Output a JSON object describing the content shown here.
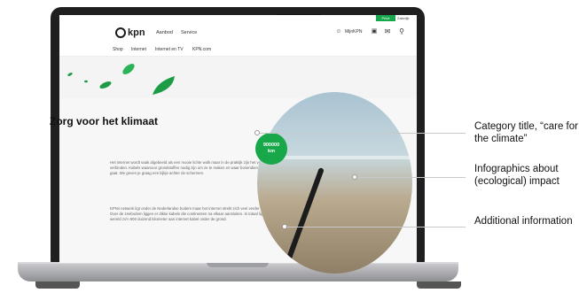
{
  "site": {
    "logo_text": "kpn",
    "top_buttons": {
      "prive": "Privé",
      "zakelijk": "Zakelijk"
    },
    "nav": [
      "Aanbod",
      "Service"
    ],
    "utility": {
      "account": "MijnKPN"
    },
    "subnav": [
      "Shop",
      "Internet",
      "Internet en TV",
      "KPN.com"
    ]
  },
  "content": {
    "title": "Zorg voor het klimaat",
    "paragraph_1": "Het internet wordt vaak afgebeeld als een mooie lichte wolk maar in de praktijk zijn het vooral veel kabels die ons verbinden. Kabels waarvoor grondstoffen nodig zijn om ze te maken en waar bovendien veel stroom doorheen gaat. We geven je graag een kijkje achter de schermen.",
    "paragraph_2": "KPNs netwerk ligt onder de Nederlandse bodem maar het internet strekt zich veel verder uit over de hele wereld. Over de zeebodem liggen er dikke kabels die continenten na elkaar aansluiten. In totaal ligt er over de hele wereld zo'n 900 duizend kilometer aan internet kabel onder de grond.",
    "stat_value": "900000",
    "stat_unit": "km"
  },
  "annotations": [
    {
      "label": "Category title, “care for the climate”"
    },
    {
      "label": "Infographics about (ecological) impact"
    },
    {
      "label": "Additional information"
    }
  ],
  "colors": {
    "accent": "#18a84a",
    "bezel": "#1f1f1f"
  },
  "icons": [
    "account-icon",
    "basket-icon",
    "mail-icon",
    "search-icon"
  ]
}
